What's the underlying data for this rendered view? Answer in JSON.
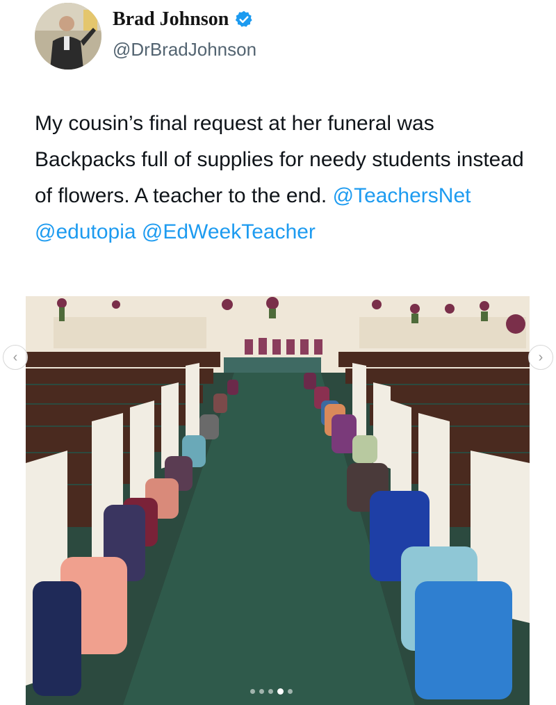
{
  "tweet": {
    "author_name": "Brad Johnson",
    "handle": "@DrBradJohnson",
    "verified": true,
    "text_plain": "My cousin’s final request at her funeral was Backpacks full of supplies for needy students instead of flowers.  A teacher to the end.",
    "mentions": [
      "@TeachersNet",
      "@edutopia",
      "@EdWeekTeacher"
    ],
    "colors": {
      "mention": "#1d9bf0",
      "verified": "#1d9bf0",
      "handle": "#536471"
    }
  },
  "media": {
    "alt_icon": "photo",
    "carousel": {
      "count": 5,
      "active_index": 3
    }
  },
  "icons": {
    "prev": "chevron-left-icon",
    "next": "chevron-right-icon",
    "verified": "verified-badge-icon"
  }
}
